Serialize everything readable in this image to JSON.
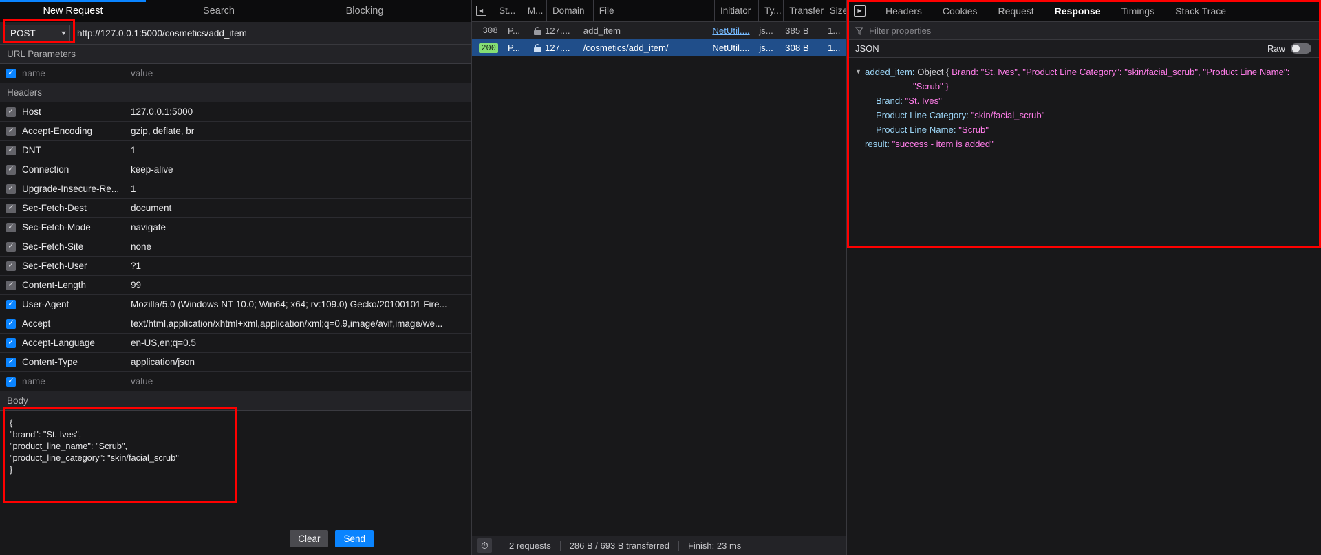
{
  "composer": {
    "tabs": [
      {
        "label": "New Request",
        "active": true
      },
      {
        "label": "Search",
        "active": false
      },
      {
        "label": "Blocking",
        "active": false
      }
    ],
    "method": "POST",
    "url": "http://127.0.0.1:5000/cosmetics/add_item",
    "url_placeholder": "http://127.0.0.1:5000/cosmetics/add_item",
    "url_params_title": "URL Parameters",
    "url_params_rows": [
      {
        "checked": true,
        "style": "blue",
        "name": "name",
        "value": "value",
        "placeholder": true
      }
    ],
    "headers_title": "Headers",
    "header_rows": [
      {
        "checked": true,
        "style": "gray",
        "name": "Host",
        "value": "127.0.0.1:5000"
      },
      {
        "checked": true,
        "style": "gray",
        "name": "Accept-Encoding",
        "value": "gzip, deflate, br"
      },
      {
        "checked": true,
        "style": "gray",
        "name": "DNT",
        "value": "1"
      },
      {
        "checked": true,
        "style": "gray",
        "name": "Connection",
        "value": "keep-alive"
      },
      {
        "checked": true,
        "style": "gray",
        "name": "Upgrade-Insecure-Re...",
        "value": "1"
      },
      {
        "checked": true,
        "style": "gray",
        "name": "Sec-Fetch-Dest",
        "value": "document"
      },
      {
        "checked": true,
        "style": "gray",
        "name": "Sec-Fetch-Mode",
        "value": "navigate"
      },
      {
        "checked": true,
        "style": "gray",
        "name": "Sec-Fetch-Site",
        "value": "none"
      },
      {
        "checked": true,
        "style": "gray",
        "name": "Sec-Fetch-User",
        "value": "?1"
      },
      {
        "checked": true,
        "style": "gray",
        "name": "Content-Length",
        "value": "99"
      },
      {
        "checked": true,
        "style": "blue",
        "name": "User-Agent",
        "value": "Mozilla/5.0 (Windows NT 10.0; Win64; x64; rv:109.0) Gecko/20100101 Fire..."
      },
      {
        "checked": true,
        "style": "blue",
        "name": "Accept",
        "value": "text/html,application/xhtml+xml,application/xml;q=0.9,image/avif,image/we..."
      },
      {
        "checked": true,
        "style": "blue",
        "name": "Accept-Language",
        "value": "en-US,en;q=0.5"
      },
      {
        "checked": true,
        "style": "blue",
        "name": "Content-Type",
        "value": "application/json"
      },
      {
        "checked": true,
        "style": "blue",
        "name": "name",
        "value": "value",
        "placeholder": true
      }
    ],
    "body_title": "Body",
    "body_text": "{\n\"brand\": \"St. Ives\",\n\"product_line_name\": \"Scrub\",\n\"product_line_category\": \"skin/facial_scrub\"\n}",
    "clear_label": "Clear",
    "send_label": "Send"
  },
  "network": {
    "collapse_icon": "collapse-panel-icon",
    "columns": [
      "St...",
      "M...",
      "Domain",
      "File",
      "Initiator",
      "Ty...",
      "Transfer...",
      "Size"
    ],
    "rows": [
      {
        "status": "308",
        "status_style": "plain",
        "method": "P...",
        "secure": true,
        "domain": "127....",
        "file": "add_item",
        "initiator": "NetUtil....",
        "type": "js...",
        "transferred": "385 B",
        "size": "1...",
        "selected": false
      },
      {
        "status": "200",
        "status_style": "pill",
        "method": "P...",
        "secure": true,
        "domain": "127....",
        "file": "/cosmetics/add_item/",
        "initiator": "NetUtil....",
        "type": "js...",
        "transferred": "308 B",
        "size": "1...",
        "selected": true
      }
    ],
    "status_bar": {
      "timer_icon": "stopwatch-icon",
      "requests": "2 requests",
      "transferred": "286 B / 693 B transferred",
      "finish": "Finish: 23 ms"
    }
  },
  "response": {
    "play_icon": "play-in-box-icon",
    "tabs": [
      {
        "label": "Headers",
        "active": false
      },
      {
        "label": "Cookies",
        "active": false
      },
      {
        "label": "Request",
        "active": false
      },
      {
        "label": "Response",
        "active": true
      },
      {
        "label": "Timings",
        "active": false
      },
      {
        "label": "Stack Trace",
        "active": false
      }
    ],
    "filter_placeholder": "Filter properties",
    "filter_icon": "funnel-icon",
    "format_label": "JSON",
    "raw_label": "Raw",
    "raw_on": false,
    "tree": {
      "root_key": "added_item:",
      "root_preview_prefix": "Object { ",
      "root_line1": "Brand: \"St. Ives\", \"Product Line Category\": \"skin/facial_scrub\", \"Product Line Name\":",
      "root_line2": "\"Scrub\" }",
      "children": [
        {
          "key": "Brand:",
          "value": "\"St. Ives\""
        },
        {
          "key": "Product Line Category:",
          "value": "\"skin/facial_scrub\""
        },
        {
          "key": "Product Line Name:",
          "value": "\"Scrub\""
        }
      ],
      "result_key": "result:",
      "result_value": "\"success - item is added\""
    }
  },
  "annotations": {
    "color": "#ff0000",
    "boxes": [
      "method-select-highlight",
      "body-section-highlight",
      "response-panel-highlight"
    ]
  }
}
